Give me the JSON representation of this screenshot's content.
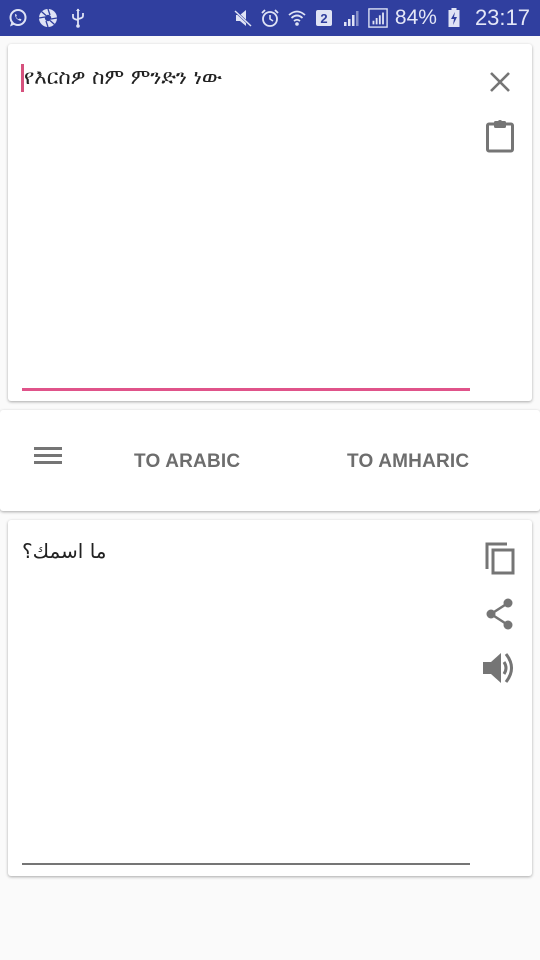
{
  "status_bar": {
    "left_icons": [
      "whatsapp-icon",
      "aperture-icon",
      "usb-icon"
    ],
    "right_icons": [
      "mute-icon",
      "alarm-icon",
      "wifi-icon",
      "sim-2-icon",
      "signal-icon",
      "signal-icon-boxed"
    ],
    "sim_label": "2",
    "battery_percent": "84%",
    "battery_icon": "battery-charging-icon",
    "time": "23:17"
  },
  "input_card": {
    "text": "የእርስዎ ስም ምንድን ነው",
    "clear_icon": "close-icon",
    "paste_icon": "clipboard-icon",
    "accent_color": "#e0538a"
  },
  "toolbar": {
    "menu_icon": "menu-icon",
    "to_arabic_label": "TO ARABIC",
    "to_amharic_label": "TO AMHARIC"
  },
  "output_card": {
    "text": "ما اسمك؟",
    "copy_icon": "copy-icon",
    "share_icon": "share-icon",
    "speak_icon": "speaker-icon"
  },
  "colors": {
    "status_bar": "#303f9f",
    "icon_gray": "#757575",
    "accent_pink": "#e0538a",
    "background": "#fafafa"
  }
}
